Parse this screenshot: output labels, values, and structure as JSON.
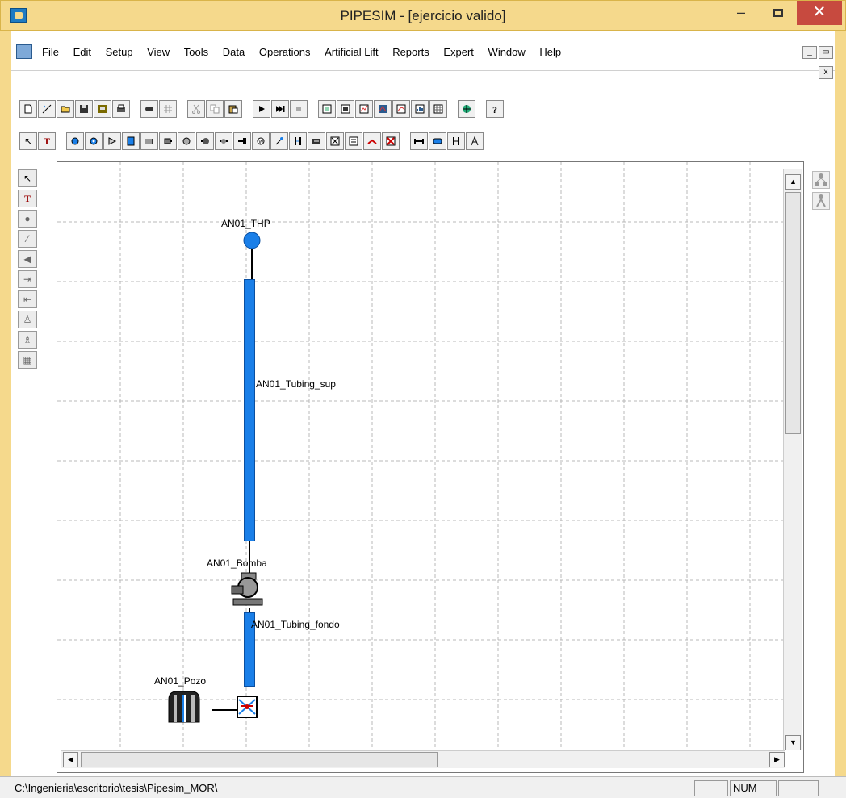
{
  "window": {
    "title": "PIPESIM - [ejercicio valido]",
    "min_glyph": "–",
    "close_glyph": "✕"
  },
  "menu": {
    "items": [
      "File",
      "Edit",
      "Setup",
      "View",
      "Tools",
      "Data",
      "Operations",
      "Artificial Lift",
      "Reports",
      "Expert",
      "Window",
      "Help"
    ],
    "mdi_min": "_",
    "mdi_restore": "▭",
    "mdi_close": "x"
  },
  "toolbar1": {
    "buttons": [
      "new",
      "wizard",
      "open",
      "save",
      "save-all",
      "print",
      "find",
      "grid",
      "cut",
      "copy",
      "paste",
      "run",
      "run-next",
      "stop",
      "report-1",
      "report-2",
      "plot-1",
      "plot-2",
      "plot-3",
      "table",
      "globe",
      "help"
    ]
  },
  "toolbar2": {
    "select_glyph": "↖",
    "text_glyph": "T"
  },
  "left_tools": {
    "glyphs": [
      "↖",
      "T",
      "●",
      "⁄",
      "◀",
      "⇥",
      "⇤",
      "♙",
      "♗",
      "▦"
    ]
  },
  "canvas": {
    "labels": {
      "thp": "AN01_THP",
      "tubing_sup": "AN01_Tubing_sup",
      "bomba": "AN01_Bomba",
      "tubing_fondo": "AN01_Tubing_fondo",
      "pozo": "AN01_Pozo"
    },
    "colors": {
      "pipe": "#1a7fe8",
      "node": "#1a7fe8",
      "grid": "#b8b8b8"
    }
  },
  "scroll": {
    "up": "▲",
    "down": "▼",
    "left": "◀",
    "right": "▶"
  },
  "status": {
    "path": "C:\\Ingenieria\\escritorio\\tesis\\Pipesim_MOR\\",
    "num": "NUM"
  }
}
